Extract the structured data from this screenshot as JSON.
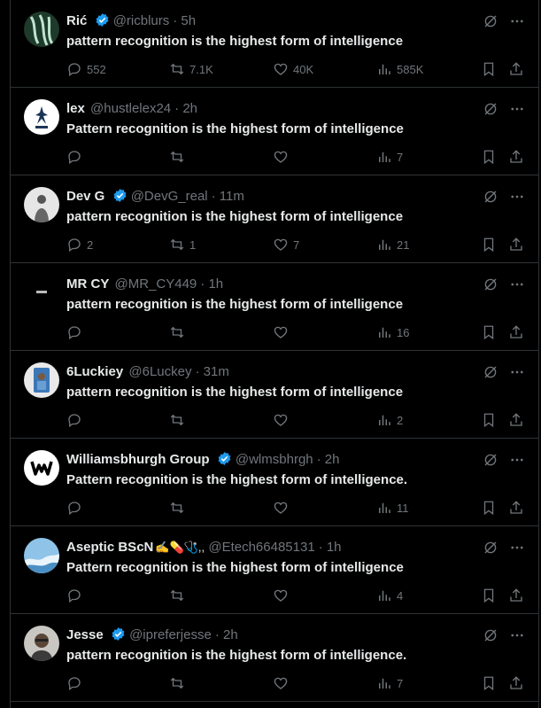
{
  "colors": {
    "background": "#000000",
    "text": "#e7e9ea",
    "muted": "#71767b",
    "verified": "#1d9bf0",
    "divider": "#2f3336"
  },
  "posts": [
    {
      "name": "Rić",
      "emoji": "",
      "verified": true,
      "handle": "@ricblurs",
      "time": "· 5h",
      "text": "pattern recognition is the highest form of intelligence",
      "replies": "552",
      "reposts": "7.1K",
      "likes": "40K",
      "views": "585K"
    },
    {
      "name": "lex",
      "emoji": "",
      "verified": false,
      "handle": "@hustlelex24",
      "time": "· 2h",
      "text": "Pattern recognition is the highest form of intelligence",
      "replies": "",
      "reposts": "",
      "likes": "",
      "views": "7"
    },
    {
      "name": "Dev G",
      "emoji": "",
      "verified": true,
      "handle": "@DevG_real",
      "time": "· 11m",
      "text": "pattern recognition is the highest form of intelligence",
      "replies": "2",
      "reposts": "1",
      "likes": "7",
      "views": "21"
    },
    {
      "name": "MR CY",
      "emoji": "",
      "verified": false,
      "handle": "@MR_CY449",
      "time": "· 1h",
      "text": "pattern recognition is the highest form of intelligence",
      "replies": "",
      "reposts": "",
      "likes": "",
      "views": "16"
    },
    {
      "name": "6Luckiey",
      "emoji": "",
      "verified": false,
      "handle": "@6Luckey",
      "time": "· 31m",
      "text": "pattern recognition is the highest form of intelligence",
      "replies": "",
      "reposts": "",
      "likes": "",
      "views": "2"
    },
    {
      "name": "Williamsbhurgh Group",
      "emoji": "",
      "verified": true,
      "handle": "@wlmsbhrgh",
      "time": "· 2h",
      "text": "Pattern recognition is the highest form of intelligence.",
      "replies": "",
      "reposts": "",
      "likes": "",
      "views": "11"
    },
    {
      "name": "Aseptic BScN",
      "emoji": "✍💊🩺,,",
      "verified": false,
      "handle": "@Etech66485131",
      "time": "· 1h",
      "text": "Pattern recognition is the highest form of intelligence",
      "replies": "",
      "reposts": "",
      "likes": "",
      "views": "4"
    },
    {
      "name": "Jesse",
      "emoji": "",
      "verified": true,
      "handle": "@ipreferjesse",
      "time": "· 2h",
      "text": "pattern recognition is the highest form of intelligence.",
      "replies": "",
      "reposts": "",
      "likes": "",
      "views": "7"
    }
  ]
}
